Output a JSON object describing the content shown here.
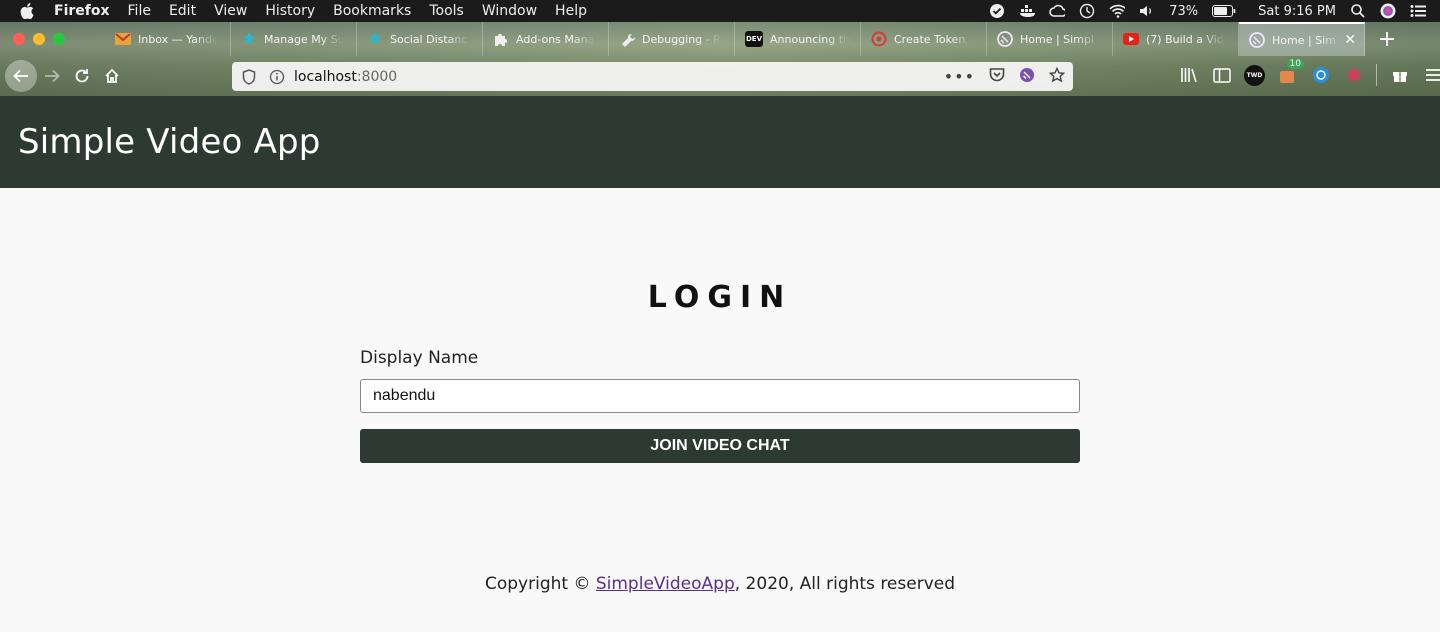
{
  "menubar": {
    "app_name": "Firefox",
    "items": [
      "File",
      "Edit",
      "View",
      "History",
      "Bookmarks",
      "Tools",
      "Window",
      "Help"
    ],
    "battery": "73%",
    "clock": "Sat 9:16 PM"
  },
  "tabs": [
    {
      "label": "Inbox — Yande",
      "icon": "mail-icon",
      "color": "#e8a33a"
    },
    {
      "label": "Manage My Su",
      "icon": "twilio-icon",
      "color": "#2bb6c9"
    },
    {
      "label": "Social Distanc",
      "icon": "twilio-icon",
      "color": "#2bb6c9"
    },
    {
      "label": "Add-ons Mana",
      "icon": "puzzle-icon",
      "color": "#e0e0e0"
    },
    {
      "label": "Debugging - R",
      "icon": "wrench-icon",
      "color": "#e0e0e0"
    },
    {
      "label": "Announcing th",
      "icon": "dev-icon",
      "color": "#111111",
      "icon_text": "DEV"
    },
    {
      "label": "Create Token",
      "icon": "circle-logo-icon",
      "color": "#d63a3a"
    },
    {
      "label": "Home | Simpl",
      "icon": "gatsby-icon",
      "color": "#7a4fb6"
    },
    {
      "label": "(7) Build a Vid",
      "icon": "youtube-icon",
      "color": "#e62117"
    },
    {
      "label": "Home | Sim",
      "icon": "gatsby-icon",
      "color": "#7a4fb6",
      "active": true
    }
  ],
  "urlbar": {
    "host": "localhost",
    "port": ":8000"
  },
  "toolbar": {
    "extension_badge": "10",
    "twd_label": "TWD"
  },
  "page": {
    "header_title": "Simple Video App",
    "login_title": "LOGIN",
    "display_name_label": "Display Name",
    "display_name_value": "nabendu",
    "join_button": "JOIN VIDEO CHAT",
    "footer_prefix": "Copyright © ",
    "footer_link": "SimpleVideoApp",
    "footer_suffix": ", 2020, All rights reserved"
  },
  "colors": {
    "header_bg": "#2c3a33",
    "link": "#5b2d91",
    "page_bg": "#f9f9f9"
  }
}
